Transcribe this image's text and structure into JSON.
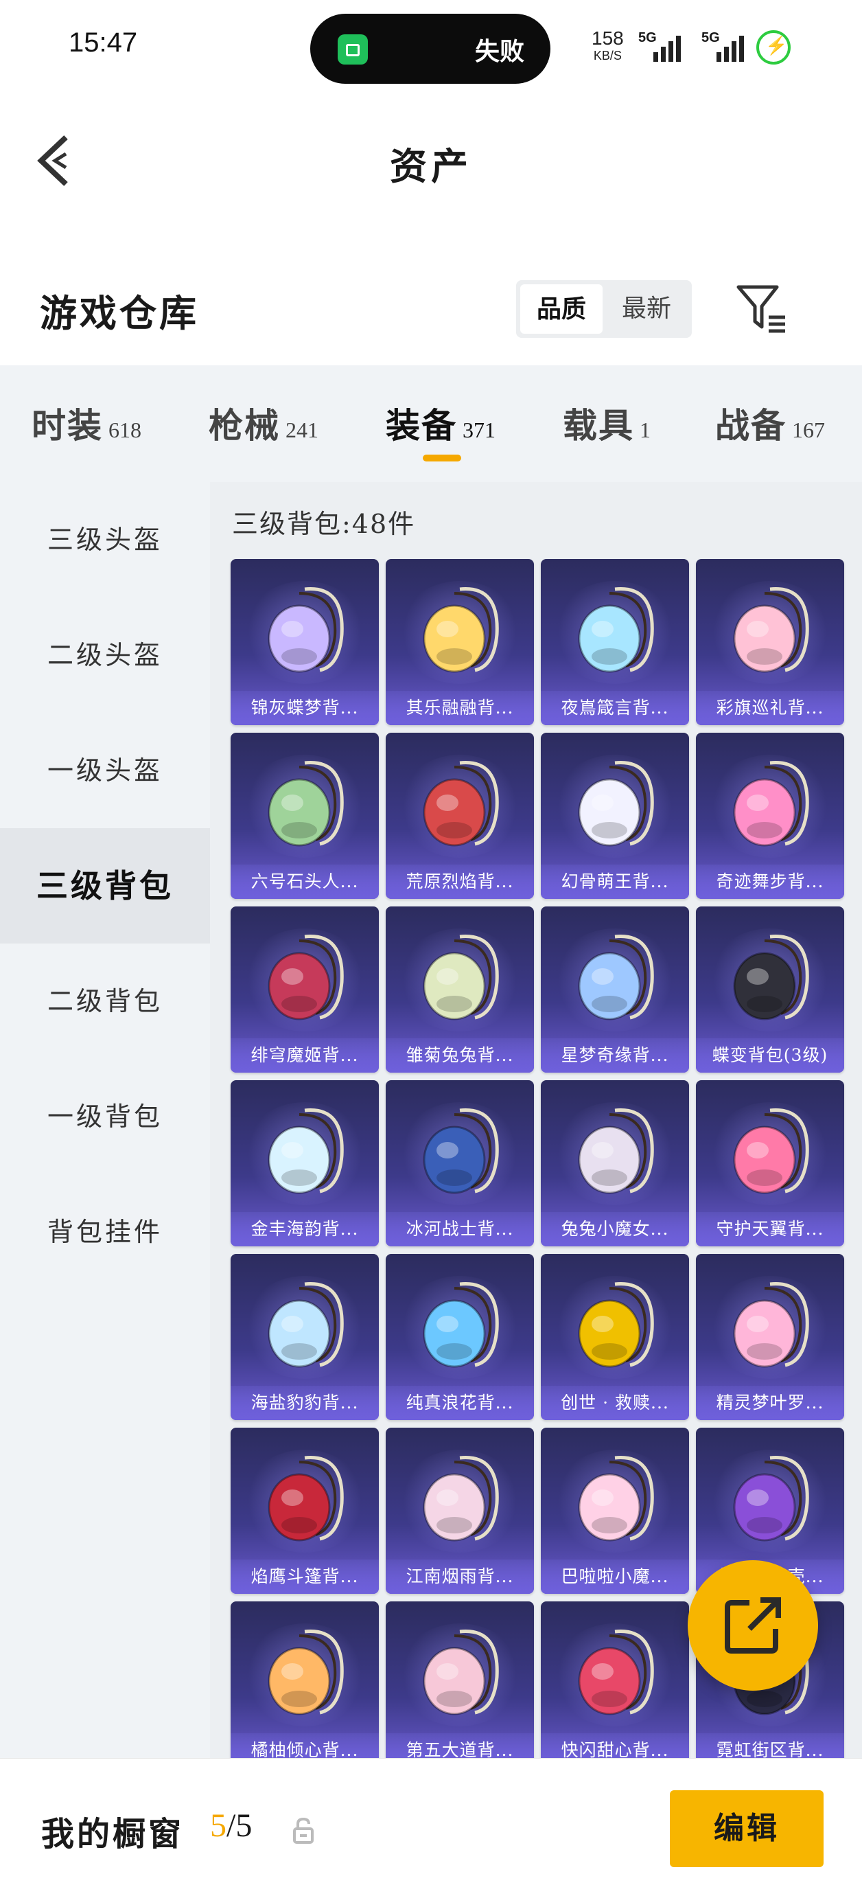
{
  "status_bar": {
    "time": "15:47",
    "island_text": "失败",
    "net_speed_value": "158",
    "net_speed_unit": "KB/S",
    "sim1": "5G",
    "sim2": "5G"
  },
  "header": {
    "title": "资产"
  },
  "section": {
    "title": "游戏仓库",
    "sort_options": [
      "品质",
      "最新"
    ]
  },
  "tabs": [
    {
      "label": "时装",
      "count": "618"
    },
    {
      "label": "枪械",
      "count": "241"
    },
    {
      "label": "装备",
      "count": "371"
    },
    {
      "label": "载具",
      "count": "1"
    },
    {
      "label": "战备",
      "count": "167"
    }
  ],
  "sidenav": [
    "三级头盔",
    "二级头盔",
    "一级头盔",
    "三级背包",
    "二级背包",
    "一级背包",
    "背包挂件"
  ],
  "content": {
    "header": "三级背包:48件",
    "items": [
      "锦灰蝶梦背...",
      "其乐融融背...",
      "夜嶌箴言背...",
      "彩旗巡礼背...",
      "六号石头人...",
      "荒原烈焰背...",
      "幻骨萌王背...",
      "奇迹舞步背...",
      "绯穹魔姬背...",
      "雏菊兔兔背...",
      "星梦奇缘背...",
      "蝶变背包(3级)",
      "金丰海韵背...",
      "冰河战士背...",
      "兔兔小魔女...",
      "守护天翼背...",
      "海盐豹豹背...",
      "纯真浪花背...",
      "创世 · 救赎...",
      "精灵梦叶罗...",
      "焰鹰斗篷背...",
      "江南烟雨背...",
      "巴啦啦小魔...",
      "龟仙奇兔壳...",
      "橘柚倾心背...",
      "第五大道背...",
      "快闪甜心背...",
      "霓虹街区背..."
    ]
  },
  "colors": {
    "accent": "#f5a800",
    "card_top": "#2c2c5e",
    "card_bottom": "#6b5bd0"
  },
  "bottom": {
    "showcase_label": "我的橱窗",
    "showcase_current": "5",
    "showcase_total": "/5",
    "edit_label": "编辑"
  }
}
